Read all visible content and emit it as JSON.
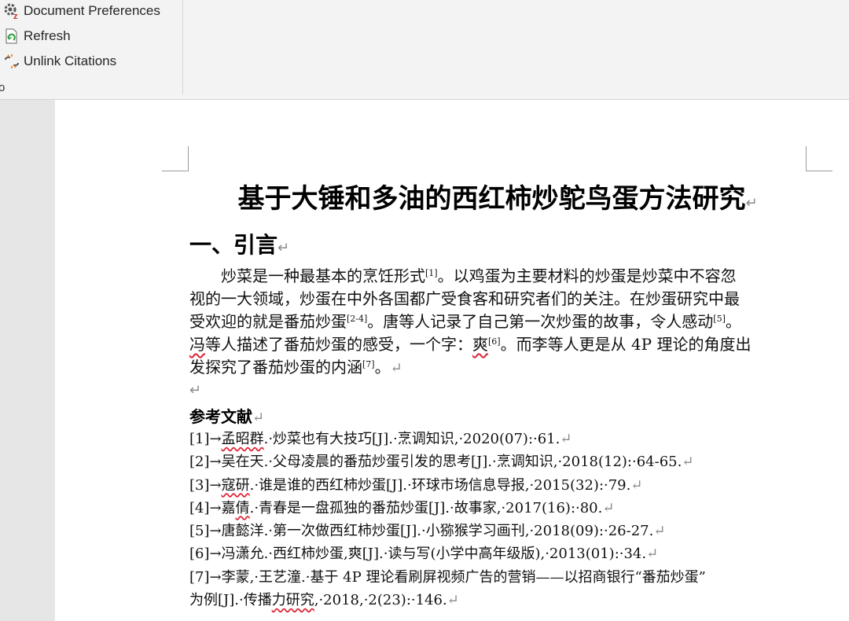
{
  "ribbon": {
    "buttons": [
      {
        "label": "Document Preferences",
        "icon": "gear-z-icon"
      },
      {
        "label": "Refresh",
        "icon": "refresh-doc-icon"
      },
      {
        "label": "Unlink Citations",
        "icon": "unlink-icon"
      }
    ],
    "group_label": "o"
  },
  "document": {
    "title": "基于大锤和多油的西红柿炒鸵鸟蛋方法研究",
    "heading1": "一、引言",
    "paragraph": {
      "l1a": "炒菜是一种最基本的烹饪形式",
      "c1": "[1]",
      "l1b": "。以鸡蛋为主要材料的炒蛋是炒菜中不容忽",
      "l2": "视的一大领域，炒蛋在中外各国都广受食客和研究者们的关注。在炒蛋研究中最",
      "l3a": "受欢迎的就是番茄炒蛋",
      "c2": "[2-4]",
      "l3b": "。唐等人记录了自己第一次炒蛋的故事，令人感动",
      "c3": "[5]",
      "l3c": "。",
      "l4a": "冯",
      "l4b": "等人描述了番茄炒蛋的感受，一个字：",
      "l4c": "爽",
      "c4": "[6]",
      "l4d": "。而李等人更是从 4P 理论的角度出",
      "l5a": "发探究了番茄炒蛋的内涵",
      "c5": "[7]",
      "l5b": "。"
    },
    "para_mark": "↵",
    "references_heading": "参考文献",
    "references": [
      {
        "a": "[1]→",
        "b": "孟昭群",
        "c": ".·炒菜也有大技巧[J].·烹调知识,·2020(07):·61."
      },
      {
        "a": "[2]→吴在天.·父母凌晨的番茄炒蛋引发的思考[J].·烹调知识,·2018(12):·64-65.",
        "b": "",
        "c": ""
      },
      {
        "a": "[3]→",
        "b": "寇研",
        "c": ".·谁是谁的西红柿炒蛋[J].·环球市场信息导报,·2015(32):·79."
      },
      {
        "a": "[4]→嘉",
        "b": "倩",
        "c": ".·青春是一盘孤独的番茄炒蛋[J].·故事家,·2017(16):·80."
      },
      {
        "a": "[5]→唐懿洋.·第一次做西红柿炒蛋[J].·小猕猴学习画刊,·2018(09):·26-27.",
        "b": "",
        "c": ""
      },
      {
        "a": "[6]→冯潇允.·西红柿炒蛋,爽[J].·读与写(小学中高年级版),·2013(01):·34.",
        "b": "",
        "c": ""
      },
      {
        "a": "[7]→李蒙,·王艺潼.·基于 4P 理论看刷屏视频广告的营销——以招商银行“番茄炒蛋”",
        "b": "",
        "c": ""
      },
      {
        "a": "为例[J].·传播",
        "b": "力研究",
        "c": ",·2018,·2(23):·146."
      }
    ]
  }
}
